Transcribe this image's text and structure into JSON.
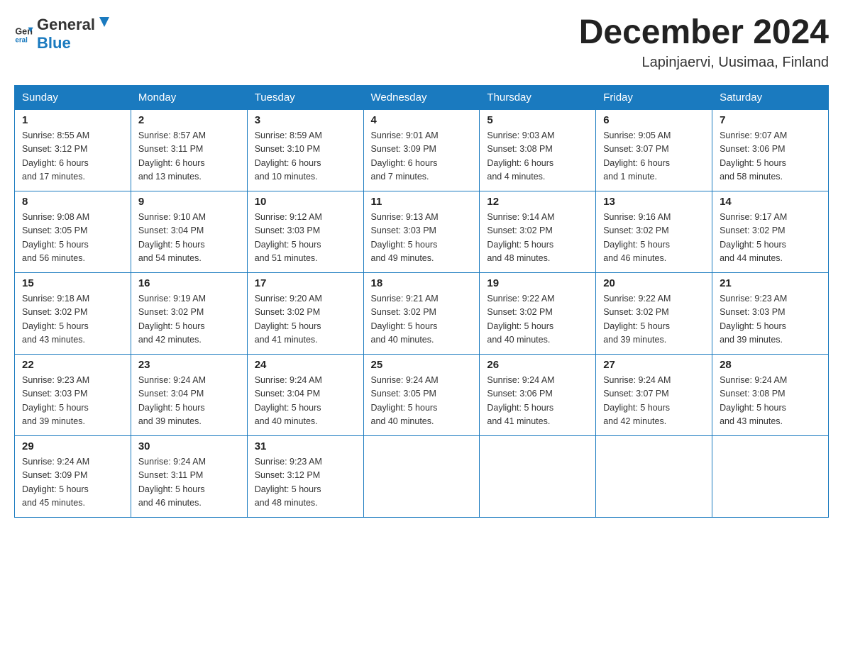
{
  "logo": {
    "text_general": "General",
    "text_blue": "Blue"
  },
  "title": "December 2024",
  "location": "Lapinjaervi, Uusimaa, Finland",
  "days_of_week": [
    "Sunday",
    "Monday",
    "Tuesday",
    "Wednesday",
    "Thursday",
    "Friday",
    "Saturday"
  ],
  "weeks": [
    [
      {
        "day": "1",
        "info": "Sunrise: 8:55 AM\nSunset: 3:12 PM\nDaylight: 6 hours\nand 17 minutes."
      },
      {
        "day": "2",
        "info": "Sunrise: 8:57 AM\nSunset: 3:11 PM\nDaylight: 6 hours\nand 13 minutes."
      },
      {
        "day": "3",
        "info": "Sunrise: 8:59 AM\nSunset: 3:10 PM\nDaylight: 6 hours\nand 10 minutes."
      },
      {
        "day": "4",
        "info": "Sunrise: 9:01 AM\nSunset: 3:09 PM\nDaylight: 6 hours\nand 7 minutes."
      },
      {
        "day": "5",
        "info": "Sunrise: 9:03 AM\nSunset: 3:08 PM\nDaylight: 6 hours\nand 4 minutes."
      },
      {
        "day": "6",
        "info": "Sunrise: 9:05 AM\nSunset: 3:07 PM\nDaylight: 6 hours\nand 1 minute."
      },
      {
        "day": "7",
        "info": "Sunrise: 9:07 AM\nSunset: 3:06 PM\nDaylight: 5 hours\nand 58 minutes."
      }
    ],
    [
      {
        "day": "8",
        "info": "Sunrise: 9:08 AM\nSunset: 3:05 PM\nDaylight: 5 hours\nand 56 minutes."
      },
      {
        "day": "9",
        "info": "Sunrise: 9:10 AM\nSunset: 3:04 PM\nDaylight: 5 hours\nand 54 minutes."
      },
      {
        "day": "10",
        "info": "Sunrise: 9:12 AM\nSunset: 3:03 PM\nDaylight: 5 hours\nand 51 minutes."
      },
      {
        "day": "11",
        "info": "Sunrise: 9:13 AM\nSunset: 3:03 PM\nDaylight: 5 hours\nand 49 minutes."
      },
      {
        "day": "12",
        "info": "Sunrise: 9:14 AM\nSunset: 3:02 PM\nDaylight: 5 hours\nand 48 minutes."
      },
      {
        "day": "13",
        "info": "Sunrise: 9:16 AM\nSunset: 3:02 PM\nDaylight: 5 hours\nand 46 minutes."
      },
      {
        "day": "14",
        "info": "Sunrise: 9:17 AM\nSunset: 3:02 PM\nDaylight: 5 hours\nand 44 minutes."
      }
    ],
    [
      {
        "day": "15",
        "info": "Sunrise: 9:18 AM\nSunset: 3:02 PM\nDaylight: 5 hours\nand 43 minutes."
      },
      {
        "day": "16",
        "info": "Sunrise: 9:19 AM\nSunset: 3:02 PM\nDaylight: 5 hours\nand 42 minutes."
      },
      {
        "day": "17",
        "info": "Sunrise: 9:20 AM\nSunset: 3:02 PM\nDaylight: 5 hours\nand 41 minutes."
      },
      {
        "day": "18",
        "info": "Sunrise: 9:21 AM\nSunset: 3:02 PM\nDaylight: 5 hours\nand 40 minutes."
      },
      {
        "day": "19",
        "info": "Sunrise: 9:22 AM\nSunset: 3:02 PM\nDaylight: 5 hours\nand 40 minutes."
      },
      {
        "day": "20",
        "info": "Sunrise: 9:22 AM\nSunset: 3:02 PM\nDaylight: 5 hours\nand 39 minutes."
      },
      {
        "day": "21",
        "info": "Sunrise: 9:23 AM\nSunset: 3:03 PM\nDaylight: 5 hours\nand 39 minutes."
      }
    ],
    [
      {
        "day": "22",
        "info": "Sunrise: 9:23 AM\nSunset: 3:03 PM\nDaylight: 5 hours\nand 39 minutes."
      },
      {
        "day": "23",
        "info": "Sunrise: 9:24 AM\nSunset: 3:04 PM\nDaylight: 5 hours\nand 39 minutes."
      },
      {
        "day": "24",
        "info": "Sunrise: 9:24 AM\nSunset: 3:04 PM\nDaylight: 5 hours\nand 40 minutes."
      },
      {
        "day": "25",
        "info": "Sunrise: 9:24 AM\nSunset: 3:05 PM\nDaylight: 5 hours\nand 40 minutes."
      },
      {
        "day": "26",
        "info": "Sunrise: 9:24 AM\nSunset: 3:06 PM\nDaylight: 5 hours\nand 41 minutes."
      },
      {
        "day": "27",
        "info": "Sunrise: 9:24 AM\nSunset: 3:07 PM\nDaylight: 5 hours\nand 42 minutes."
      },
      {
        "day": "28",
        "info": "Sunrise: 9:24 AM\nSunset: 3:08 PM\nDaylight: 5 hours\nand 43 minutes."
      }
    ],
    [
      {
        "day": "29",
        "info": "Sunrise: 9:24 AM\nSunset: 3:09 PM\nDaylight: 5 hours\nand 45 minutes."
      },
      {
        "day": "30",
        "info": "Sunrise: 9:24 AM\nSunset: 3:11 PM\nDaylight: 5 hours\nand 46 minutes."
      },
      {
        "day": "31",
        "info": "Sunrise: 9:23 AM\nSunset: 3:12 PM\nDaylight: 5 hours\nand 48 minutes."
      },
      null,
      null,
      null,
      null
    ]
  ]
}
